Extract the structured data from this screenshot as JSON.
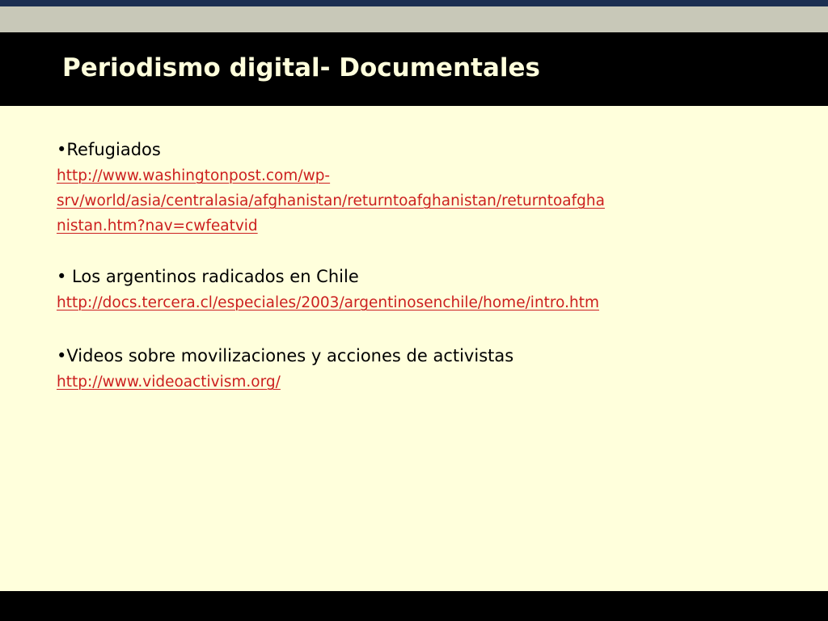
{
  "slide": {
    "title": "Periodismo digital- Documentales",
    "colors": {
      "background": "#ffffdc",
      "title_bar": "#000000",
      "title_text": "#ffffdc",
      "link": "#cc1f1f",
      "top_stripe": "#1c2f52",
      "top_band": "#c8c8b8"
    },
    "items": [
      {
        "label": "•Refugiados",
        "link_lines": [
          "http://www.washingtonpost.com/wp-",
          "srv/world/asia/centralasia/afghanistan/returntoafghanistan/returntoafgha",
          "nistan.htm?nav=cwfeatvid"
        ]
      },
      {
        "label": "• Los argentinos radicados en Chile",
        "link_lines": [
          "http://docs.tercera.cl/especiales/2003/argentinosenchile/home/intro.htm"
        ]
      },
      {
        "label": "•Videos sobre movilizaciones y acciones de activistas",
        "link_lines": [
          "http://www.videoactivism.org/"
        ]
      }
    ]
  }
}
